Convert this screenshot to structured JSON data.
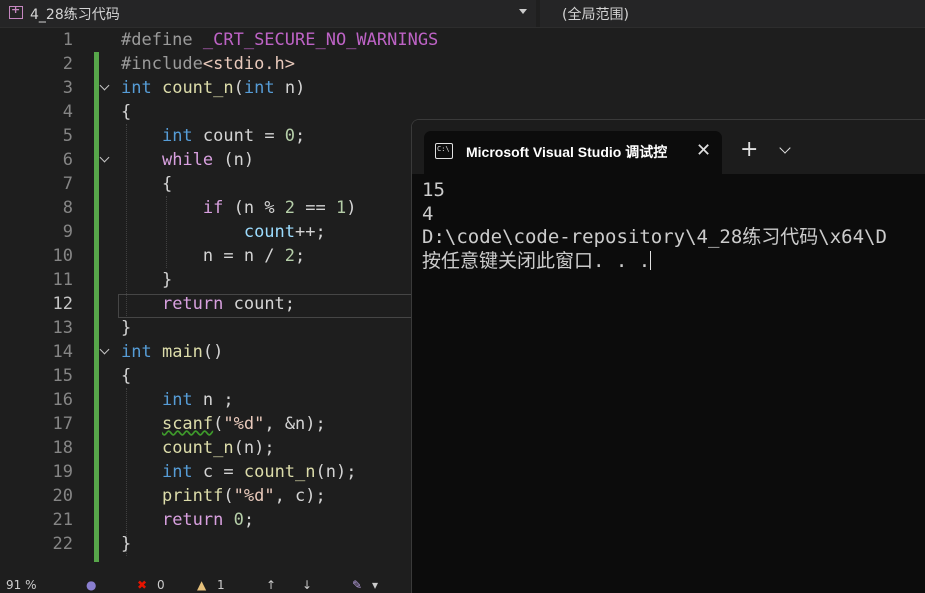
{
  "navbar": {
    "project": "4_28练习代码",
    "scope": "(全局范围)"
  },
  "code_lines": [
    {
      "n": "1"
    },
    {
      "n": "2"
    },
    {
      "n": "3"
    },
    {
      "n": "4"
    },
    {
      "n": "5"
    },
    {
      "n": "6"
    },
    {
      "n": "7"
    },
    {
      "n": "8"
    },
    {
      "n": "9"
    },
    {
      "n": "10"
    },
    {
      "n": "11"
    },
    {
      "n": "12"
    },
    {
      "n": "13"
    },
    {
      "n": "14"
    },
    {
      "n": "15"
    },
    {
      "n": "16"
    },
    {
      "n": "17"
    },
    {
      "n": "18"
    },
    {
      "n": "19"
    },
    {
      "n": "20"
    },
    {
      "n": "21"
    },
    {
      "n": "22"
    }
  ],
  "code": {
    "l1": {
      "a": "#define ",
      "b": "_CRT_SECURE_NO_WARNINGS"
    },
    "l2": {
      "a": "#include",
      "b": "<stdio.h>"
    },
    "l3": {
      "a": "int",
      "b": " ",
      "c": "count_n",
      "d": "(",
      "e": "int",
      "f": " n)"
    },
    "l4": "{",
    "l5": {
      "a": "    ",
      "b": "int",
      "c": " count = ",
      "d": "0",
      "e": ";"
    },
    "l6": {
      "a": "    ",
      "b": "while",
      "c": " (n)"
    },
    "l7": "    {",
    "l8": {
      "a": "        ",
      "b": "if",
      "c": " (n % ",
      "d": "2",
      "e": " == ",
      "f": "1",
      "g": ")"
    },
    "l9": {
      "a": "            ",
      "b": "count",
      "c": "++;"
    },
    "l10": {
      "a": "        n = n / ",
      "b": "2",
      "c": ";"
    },
    "l11": "    }",
    "l12": {
      "a": "    ",
      "b": "return",
      "c": " count;"
    },
    "l13": "}",
    "l14": {
      "a": "int",
      "b": " ",
      "c": "main",
      "d": "()"
    },
    "l15": "{",
    "l16": {
      "a": "    ",
      "b": "int",
      "c": " n ;"
    },
    "l17": {
      "a": "    ",
      "b": "scanf",
      "c": "(",
      "d": "\"%d\"",
      "e": ", &n);"
    },
    "l18": {
      "a": "    ",
      "b": "count_n",
      "c": "(n);"
    },
    "l19": {
      "a": "    ",
      "b": "int",
      "c": " c = ",
      "d": "count_n",
      "e": "(n);"
    },
    "l20": {
      "a": "    ",
      "b": "printf",
      "c": "(",
      "d": "\"%d\"",
      "e": ", c);"
    },
    "l21": {
      "a": "    ",
      "b": "return",
      "c": " ",
      "d": "0",
      "e": ";"
    },
    "l22": "}"
  },
  "status": {
    "zoom": "91 %",
    "errors": "0",
    "warnings": "1"
  },
  "terminal": {
    "tab_title": "Microsoft Visual Studio 调试控",
    "close_glyph": "✕",
    "plus_glyph": "+",
    "icon_text": "C:\\",
    "lines": [
      "15",
      "4",
      "D:\\code\\code-repository\\4_28练习代码\\x64\\D",
      "按任意键关闭此窗口. . ."
    ]
  },
  "colors": {
    "keyword": "#569cd6",
    "control": "#d8a0df",
    "function": "#dcdcaa",
    "number": "#b5cea8",
    "string": "#e8c9bb",
    "changed_bar": "#57a64a"
  }
}
